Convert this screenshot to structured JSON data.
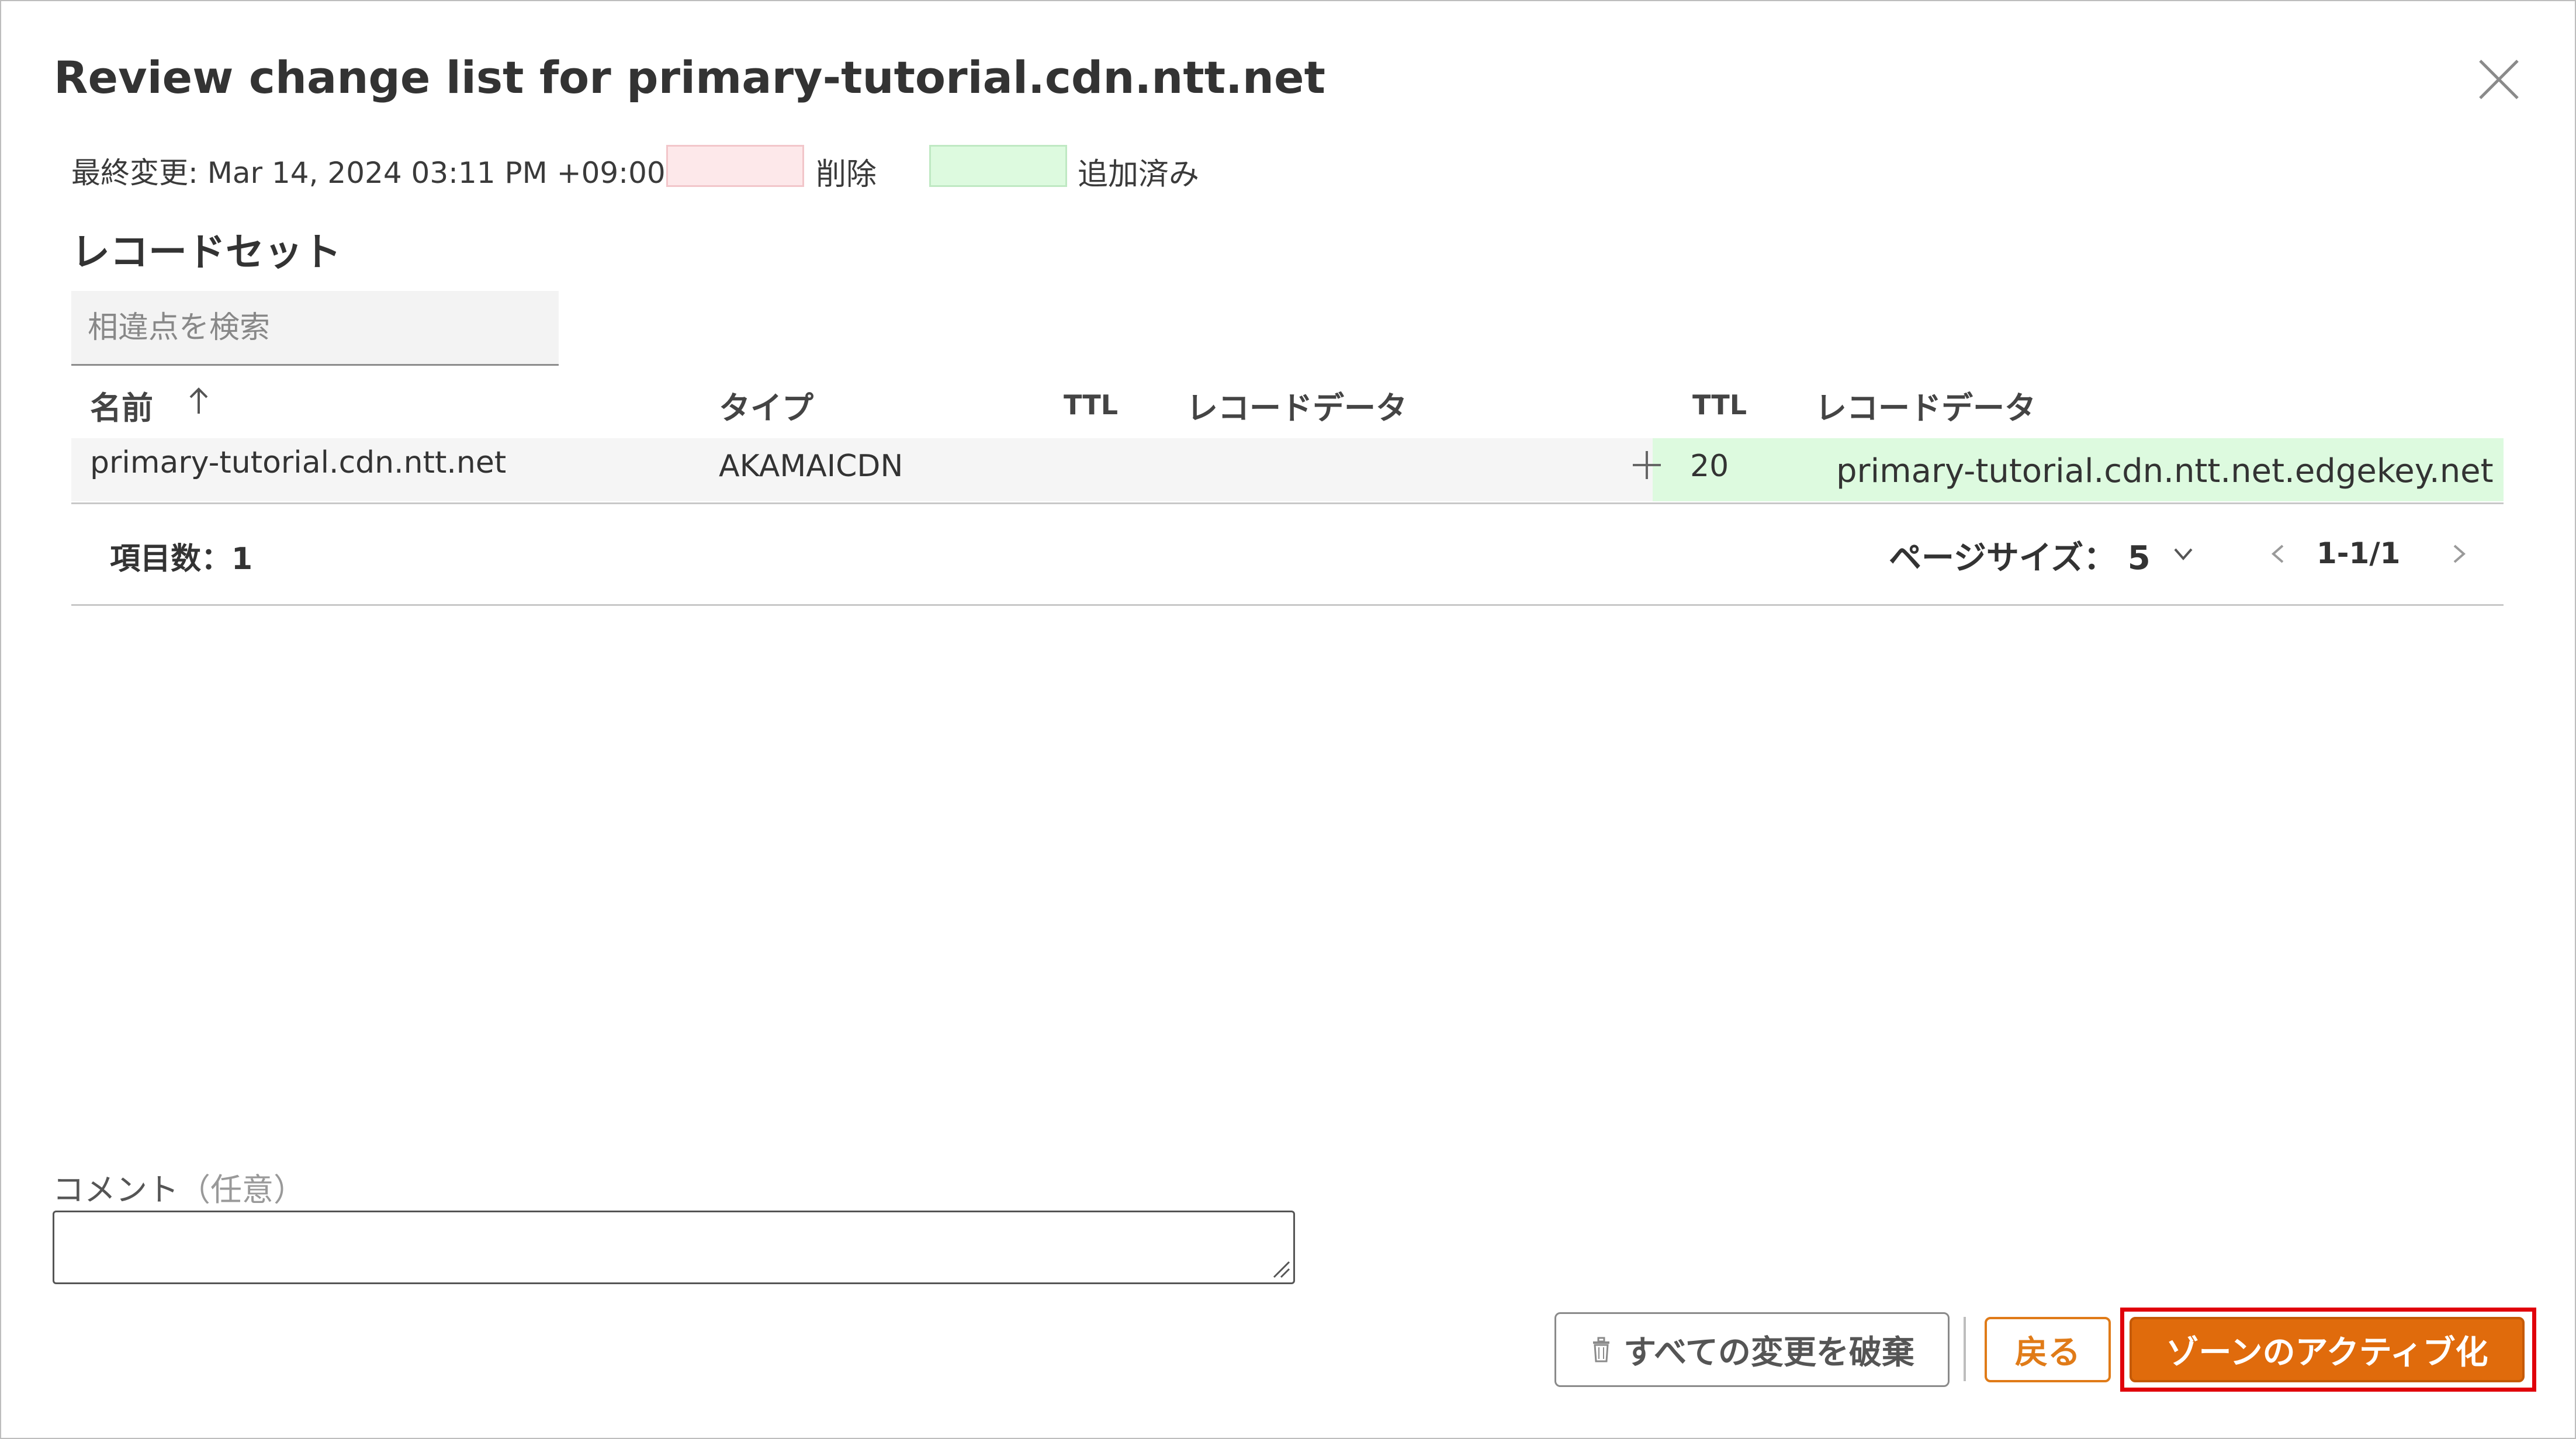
{
  "dialog": {
    "title": "Review change list for primary-tutorial.cdn.ntt.net",
    "last_modified_label": "最終変更:",
    "last_modified_value": "Mar 14, 2024 03:11 PM +09:00",
    "legend": {
      "deleted_label": "削除",
      "added_label": "追加済み",
      "deleted_color": "#fde8ea",
      "added_color": "#ddfadf"
    },
    "section_title": "レコードセット",
    "search": {
      "placeholder": "相違点を検索",
      "value": ""
    },
    "table": {
      "columns": {
        "name": "名前",
        "type": "タイプ",
        "ttl_old": "TTL",
        "data_old": "レコードデータ",
        "ttl_new": "TTL",
        "data_new": "レコードデータ"
      },
      "sort_icon": "arrow-up-icon",
      "rows": [
        {
          "name": "primary-tutorial.cdn.ntt.net",
          "type": "AKAMAICDN",
          "ttl_old": "",
          "data_old": "",
          "change_icon": "plus-icon",
          "ttl_new": "20",
          "data_new": "primary-tutorial.cdn.ntt.net.edgekey.net"
        }
      ]
    },
    "pagination": {
      "item_count": "項目数：1",
      "page_size_label": "ページサイズ：",
      "page_size_value": "5",
      "range": "1-1/1"
    },
    "comment": {
      "label": "コメント",
      "optional": "（任意）",
      "value": ""
    },
    "buttons": {
      "discard": "すべての変更を破棄",
      "back": "戻る",
      "activate": "ゾーンのアクティブ化"
    },
    "colors": {
      "accent": "#e06b0c",
      "highlight_border": "#e0000b"
    }
  }
}
